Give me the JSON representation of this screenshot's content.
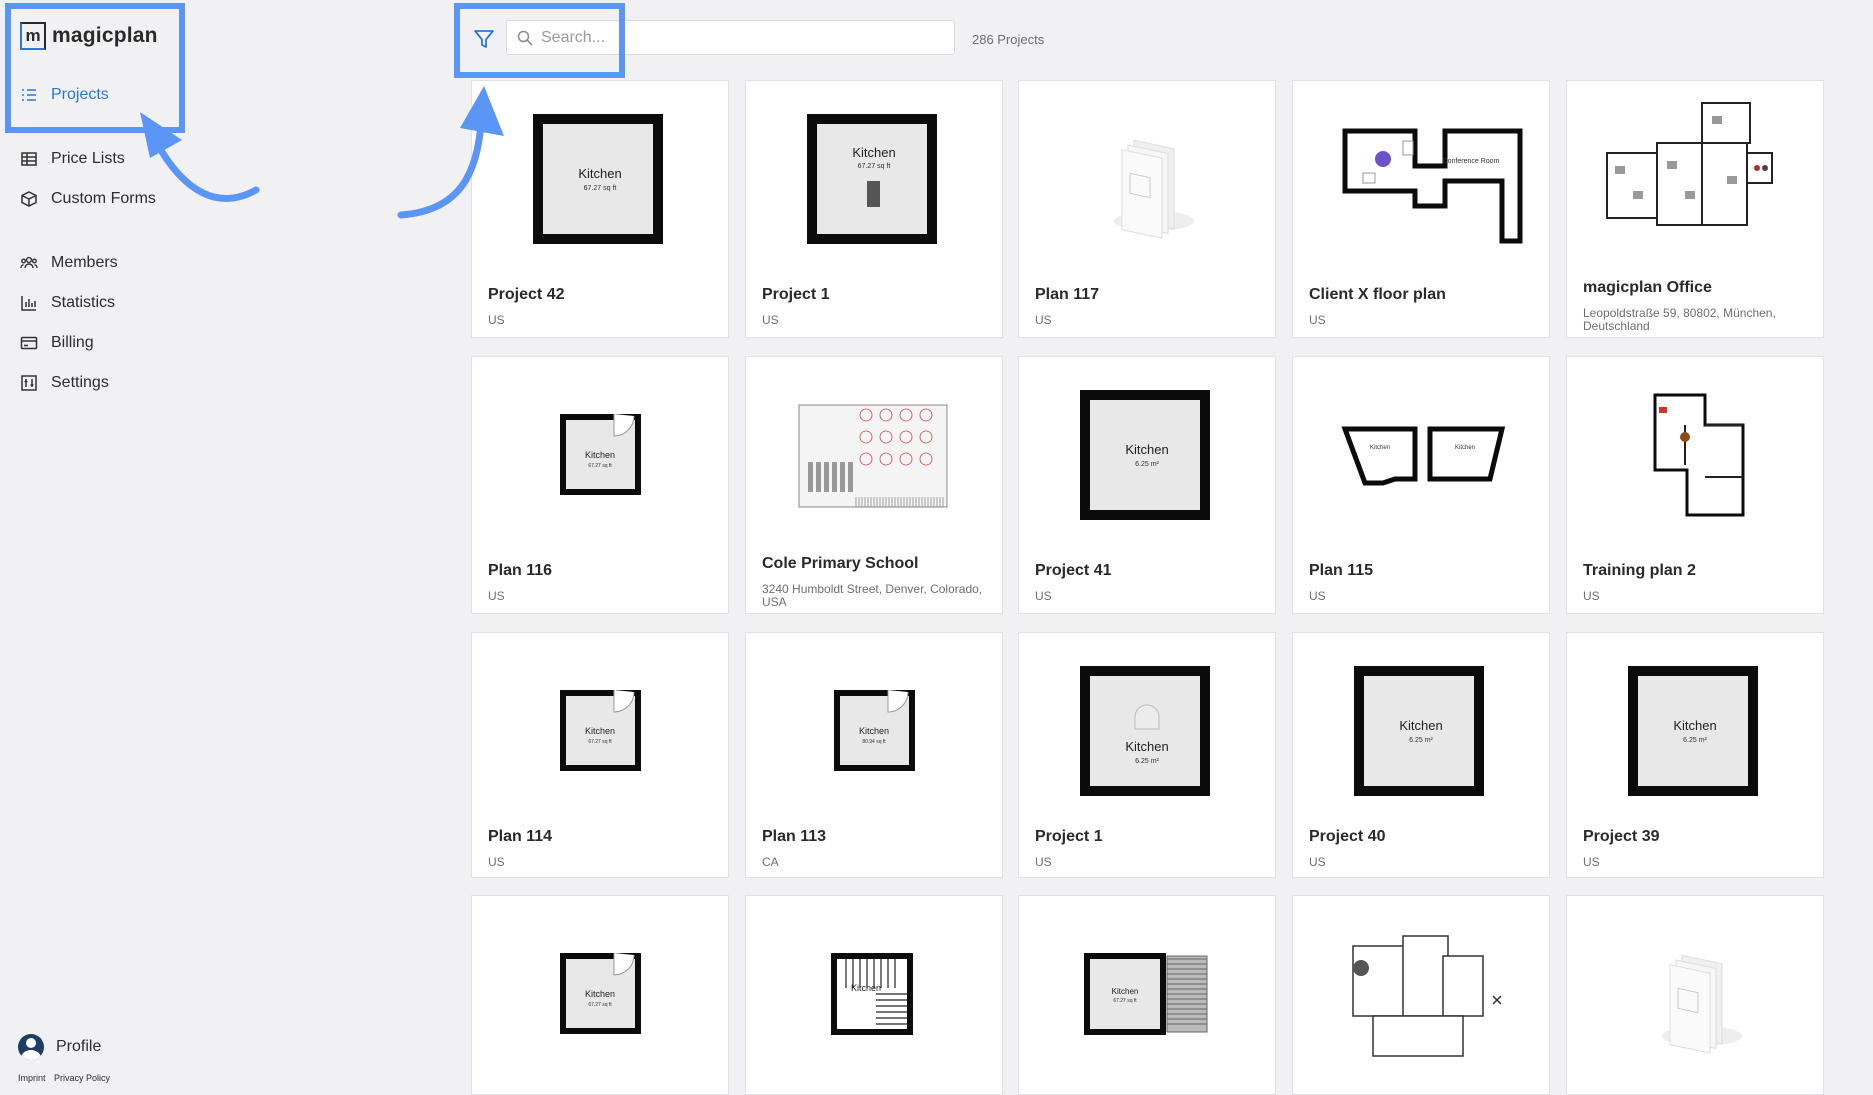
{
  "app": {
    "logo_letter": "m",
    "name": "magicplan"
  },
  "sidebar": {
    "items": [
      {
        "label": "Projects",
        "icon": "list-icon",
        "active": true
      },
      {
        "label": "Price Lists",
        "icon": "table-icon"
      },
      {
        "label": "Custom Forms",
        "icon": "box-icon"
      },
      {
        "label": "Members",
        "icon": "users-icon"
      },
      {
        "label": "Statistics",
        "icon": "bar-chart-icon"
      },
      {
        "label": "Billing",
        "icon": "credit-card-icon"
      },
      {
        "label": "Settings",
        "icon": "settings-icon"
      }
    ],
    "profile_label": "Profile",
    "footer": {
      "imprint": "Imprint",
      "privacy": "Privacy Policy"
    }
  },
  "toolbar": {
    "search_placeholder": "Search...",
    "project_count": "286 Projects"
  },
  "colors": {
    "accent": "#2a78d6",
    "highlight": "#5b95f6",
    "background": "#f1f1f4"
  },
  "projects": [
    {
      "title": "Project 42",
      "subtitle": "US",
      "thumb": "room",
      "room_label": "Kitchen",
      "area": "67.27 sq ft"
    },
    {
      "title": "Project 1",
      "subtitle": "US",
      "thumb": "room-fixture",
      "room_label": "Kitchen",
      "area": "67.27 sq ft"
    },
    {
      "title": "Plan 117",
      "subtitle": "US",
      "thumb": "placeholder"
    },
    {
      "title": "Client X floor plan",
      "subtitle": "US",
      "thumb": "office",
      "room_label": "Conference Room"
    },
    {
      "title": "magicplan Office",
      "subtitle": "Leopoldstraße 59, 80802, München, Deutschland",
      "thumb": "complex"
    },
    {
      "title": "Plan 116",
      "subtitle": "US",
      "thumb": "small-room",
      "room_label": "Kitchen",
      "area": "67.27 sq ft"
    },
    {
      "title": "Cole Primary School",
      "subtitle": "3240 Humboldt Street, Denver, Colorado, USA",
      "thumb": "school"
    },
    {
      "title": "Project 41",
      "subtitle": "US",
      "thumb": "room",
      "room_label": "Kitchen",
      "area": "6.25 m²"
    },
    {
      "title": "Plan 115",
      "subtitle": "US",
      "thumb": "two-rooms",
      "room_label": "Kitchen"
    },
    {
      "title": "Training plan 2",
      "subtitle": "US",
      "thumb": "training"
    },
    {
      "title": "Plan 114",
      "subtitle": "US",
      "thumb": "small-room",
      "room_label": "Kitchen",
      "area": "67.27 sq ft"
    },
    {
      "title": "Plan 113",
      "subtitle": "CA",
      "thumb": "small-room",
      "room_label": "Kitchen",
      "area": "80.94 sq ft"
    },
    {
      "title": "Project 1",
      "subtitle": "US",
      "thumb": "room-fixture2",
      "room_label": "Kitchen",
      "area": "6.25 m²"
    },
    {
      "title": "Project 40",
      "subtitle": "US",
      "thumb": "room",
      "room_label": "Kitchen",
      "area": "6.25 m²"
    },
    {
      "title": "Project 39",
      "subtitle": "US",
      "thumb": "room",
      "room_label": "Kitchen",
      "area": "6.25 m²"
    },
    {
      "title": "",
      "subtitle": "",
      "thumb": "small-room",
      "room_label": "Kitchen",
      "area": "67.27 sq ft"
    },
    {
      "title": "",
      "subtitle": "",
      "thumb": "stairs",
      "room_label": "Kitchen"
    },
    {
      "title": "",
      "subtitle": "",
      "thumb": "deck",
      "room_label": "Kitchen",
      "area": "67.27 sq ft"
    },
    {
      "title": "",
      "subtitle": "",
      "thumb": "house"
    },
    {
      "title": "",
      "subtitle": "",
      "thumb": "placeholder"
    }
  ]
}
